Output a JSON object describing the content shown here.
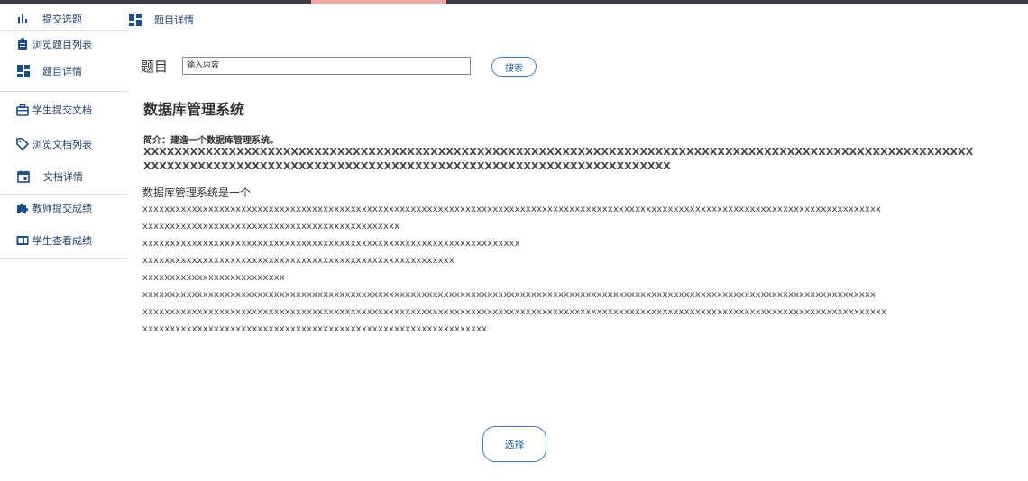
{
  "sidebar": {
    "items": [
      {
        "label": "提交选题",
        "icon": "bar-chart-icon"
      },
      {
        "label": "浏览题目列表",
        "icon": "clipboard-icon"
      },
      {
        "label": "题目详情",
        "icon": "dashboard-icon"
      },
      {
        "label": "学生提交文档",
        "icon": "briefcase-icon"
      },
      {
        "label": "浏览文档列表",
        "icon": "tag-icon"
      },
      {
        "label": "文档详情",
        "icon": "calendar-icon"
      },
      {
        "label": "教师提交成绩",
        "icon": "puzzle-icon"
      },
      {
        "label": "学生查看成绩",
        "icon": "id-card-icon"
      }
    ]
  },
  "header": {
    "breadcrumb": "题目详情",
    "icon": "dashboard-icon"
  },
  "search": {
    "label": "题目",
    "placeholder": "输入内容",
    "button": "搜索"
  },
  "detail": {
    "title": "数据库管理系统",
    "intro_label": "简介：建造一个数据库管理系统。",
    "intro_lines": [
      "XXXXXXXXXXXXXXXXXXXXXXXXXXXXXXXXXXXXXXXXXXXXXXXXXXXXXXXXXXXXXXXXXXXXXXXXXXXXXXXXXXXXXXXXXXXXXXXXXXXXXXXXXXX",
      "XXXXXXXXXXXXXXXXXXXXXXXXXXXXXXXXXXXXXXXXXXXXXXXXXXXXXXXXXXXXXXXXXXXX"
    ],
    "body_heading": "数据库管理系统是一个",
    "body_lines": [
      "xxxxxxxxxxxxxxxxxxxxxxxxxxxxxxxxxxxxxxxxxxxxxxxxxxxxxxxxxxxxxxxxxxxxxxxxxxxxxxxxxxxxxxxxxxxxxxxxxxxxxxxxxxxxxxxxxxxxxxxxxxxxxxxxxxxxxxx",
      "xxxxxxxxxxxxxxxxxxxxxxxxxxxxxxxxxxxxxxxxxxxxxxx",
      "xxxxxxxxxxxxxxxxxxxxxxxxxxxxxxxxxxxxxxxxxxxxxxxxxxxxxxxxxxxxxxxxxxxxx",
      "xxxxxxxxxxxxxxxxxxxxxxxxxxxxxxxxxxxxxxxxxxxxxxxxxxxxxxxxx",
      "xxxxxxxxxxxxxxxxxxxxxxxxxx",
      "xxxxxxxxxxxxxxxxxxxxxxxxxxxxxxxxxxxxxxxxxxxxxxxxxxxxxxxxxxxxxxxxxxxxxxxxxxxxxxxxxxxxxxxxxxxxxxxxxxxxxxxxxxxxxxxxxxxxxxxxxxxxxxxxxxxxxx",
      "xxxxxxxxxxxxxxxxxxxxxxxxxxxxxxxxxxxxxxxxxxxxxxxxxxxxxxxxxxxxxxxxxxxxxxxxxxxxxxxxxxxxxxxxxxxxxxxxxxxxxxxxxxxxxxxxxxxxxxxxxxxxxxxxxxxxxxxx",
      "xxxxxxxxxxxxxxxxxxxxxxxxxxxxxxxxxxxxxxxxxxxxxxxxxxxxxxxxxxxxxxx"
    ]
  },
  "actions": {
    "select": "选择"
  },
  "colors": {
    "accent": "#1f5fa8",
    "sidebar_text": "#1f3f66",
    "topbar": "#3a3a44",
    "topbar_highlight": "#f2a7a7"
  }
}
